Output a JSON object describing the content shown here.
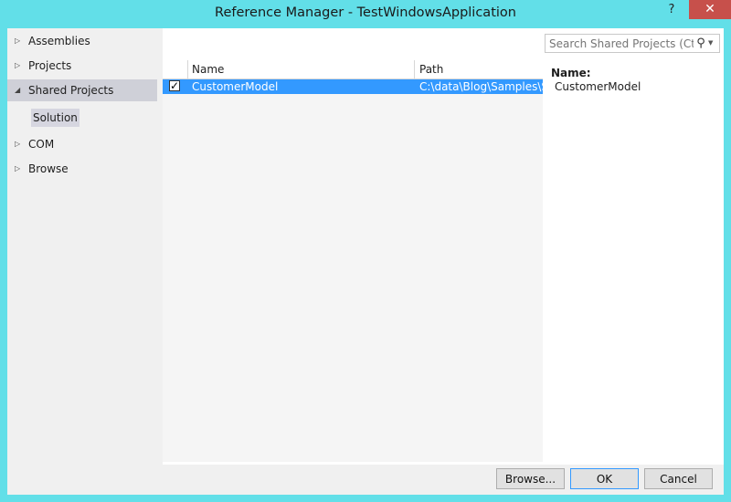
{
  "window": {
    "title": "Reference Manager - TestWindowsApplication",
    "help_label": "?",
    "close_label": "✕"
  },
  "sidebar": {
    "items": [
      {
        "label": "Assemblies",
        "arrow": "▷"
      },
      {
        "label": "Projects",
        "arrow": "▷"
      },
      {
        "label": "Shared Projects",
        "arrow": "◢",
        "selected": true
      },
      {
        "label": "COM",
        "arrow": "▷"
      },
      {
        "label": "Browse",
        "arrow": "▷"
      }
    ],
    "subitem": {
      "label": "Solution"
    }
  },
  "grid": {
    "columns": {
      "name": "Name",
      "path": "Path"
    },
    "rows": [
      {
        "checked": "✓",
        "name": "CustomerModel",
        "path": "C:\\data\\Blog\\Samples\\Sh"
      }
    ],
    "scroll_left": "◀",
    "scroll_right": "▶"
  },
  "search": {
    "placeholder": "Search Shared Projects (Ctrl+",
    "icon": "magnifier-icon",
    "icon_glyph": "⚲",
    "drop_glyph": "▼"
  },
  "detail": {
    "name_label": "Name:",
    "name_value": "CustomerModel"
  },
  "footer": {
    "browse_label": "Browse...",
    "ok_label": "OK",
    "cancel_label": "Cancel"
  },
  "colors": {
    "titlebar": "#62dfe8",
    "close": "#c7504b",
    "selection": "#3399ff"
  }
}
